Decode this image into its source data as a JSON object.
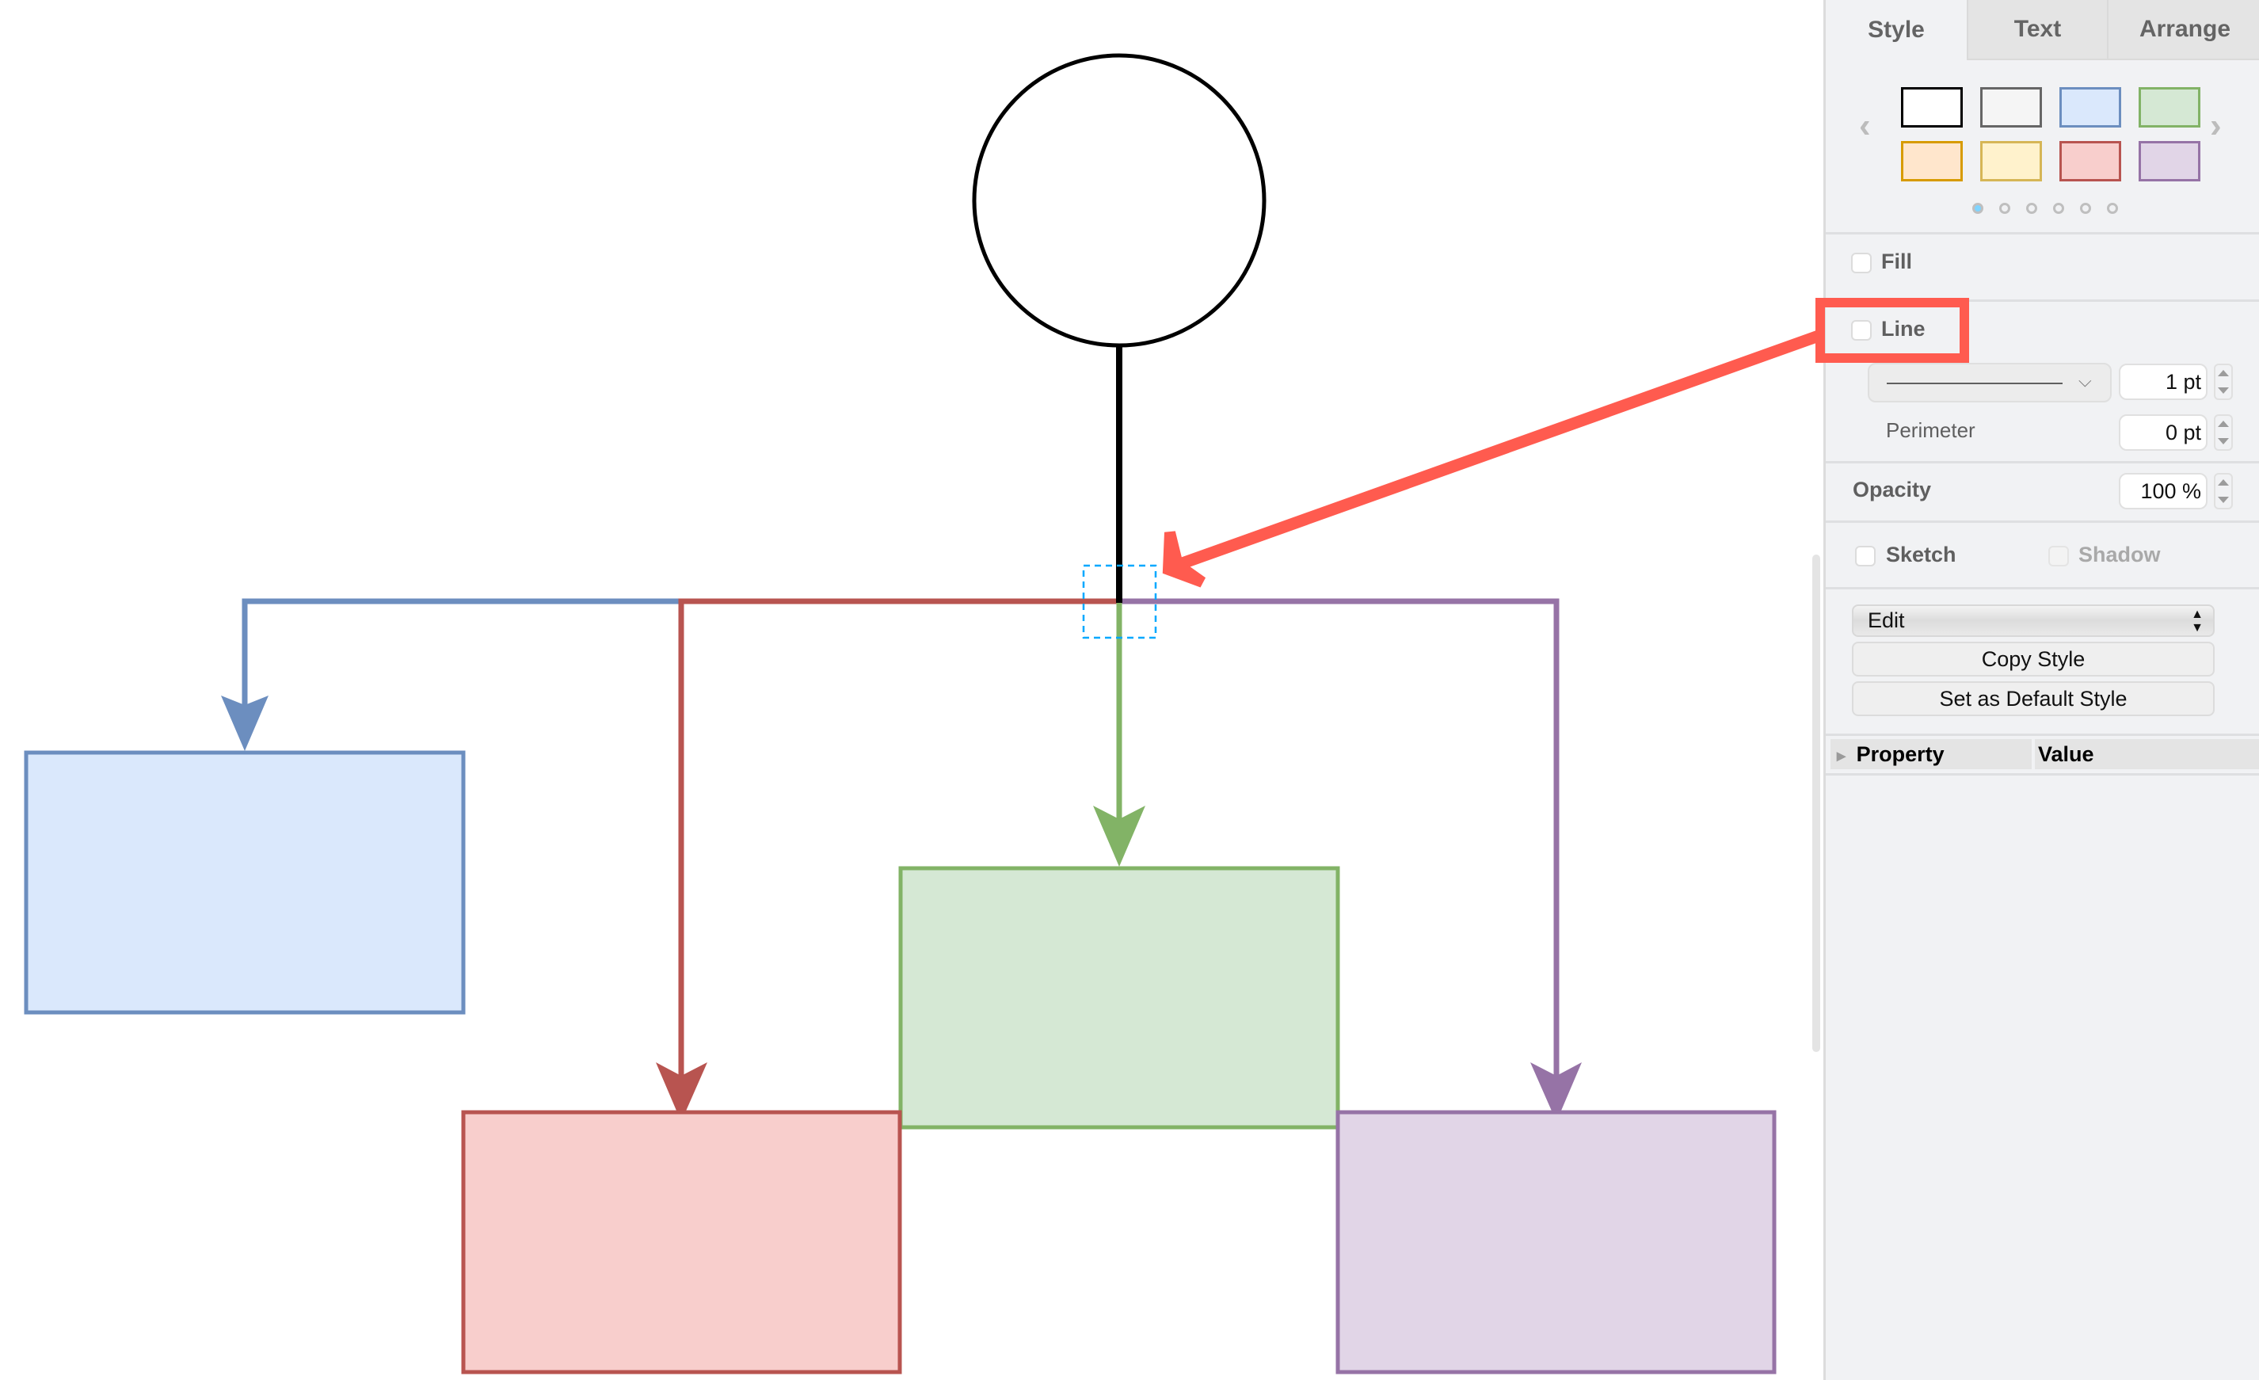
{
  "diagram": {
    "root_shape": {
      "type": "ellipse",
      "fill": "#ffffff",
      "stroke": "#000000"
    },
    "trunk_edge": {
      "stroke": "#000000",
      "selected": true
    },
    "selection_color": "#00a8ff",
    "children": [
      {
        "name": "blue",
        "fill": "#dae8fc",
        "stroke": "#6c8ebf"
      },
      {
        "name": "red",
        "fill": "#f8cecc",
        "stroke": "#b85450"
      },
      {
        "name": "green",
        "fill": "#d5e8d4",
        "stroke": "#82b366"
      },
      {
        "name": "purple",
        "fill": "#e1d5e7",
        "stroke": "#9673a6"
      }
    ],
    "annotation": {
      "color": "#ff5b4f",
      "points_to": "line-option"
    }
  },
  "panel": {
    "tabs": [
      {
        "label": "Style",
        "active": true
      },
      {
        "label": "Text",
        "active": false
      },
      {
        "label": "Arrange",
        "active": false
      }
    ],
    "swatches": [
      {
        "fill": "#ffffff",
        "stroke": "#000000"
      },
      {
        "fill": "#f5f5f5",
        "stroke": "#666666"
      },
      {
        "fill": "#dae8fc",
        "stroke": "#6c8ebf"
      },
      {
        "fill": "#d5e8d4",
        "stroke": "#82b366"
      },
      {
        "fill": "#ffe6cc",
        "stroke": "#d79b00"
      },
      {
        "fill": "#fff2cc",
        "stroke": "#d6b656"
      },
      {
        "fill": "#f8cecc",
        "stroke": "#b85450"
      },
      {
        "fill": "#e1d5e7",
        "stroke": "#9673a6"
      }
    ],
    "swatch_pages": 6,
    "swatch_page_current": 1,
    "prev_icon": "‹",
    "next_icon": "›",
    "fill": {
      "label": "Fill",
      "checked": false
    },
    "line": {
      "label": "Line",
      "checked": false,
      "width_value": "1 pt",
      "pattern": "solid",
      "dropdown_icon": "⌵"
    },
    "perimeter": {
      "label": "Perimeter",
      "value": "0 pt"
    },
    "opacity": {
      "label": "Opacity",
      "value": "100 %"
    },
    "sketch": {
      "label": "Sketch",
      "checked": false
    },
    "shadow": {
      "label": "Shadow",
      "checked": false,
      "disabled": true
    },
    "edit_select": {
      "value": "Edit",
      "arrows": "▲▼"
    },
    "copy_style": "Copy Style",
    "set_default_style": "Set as Default Style",
    "property_table": {
      "col_property": "Property",
      "col_value": "Value",
      "expand_icon": "▸"
    }
  }
}
